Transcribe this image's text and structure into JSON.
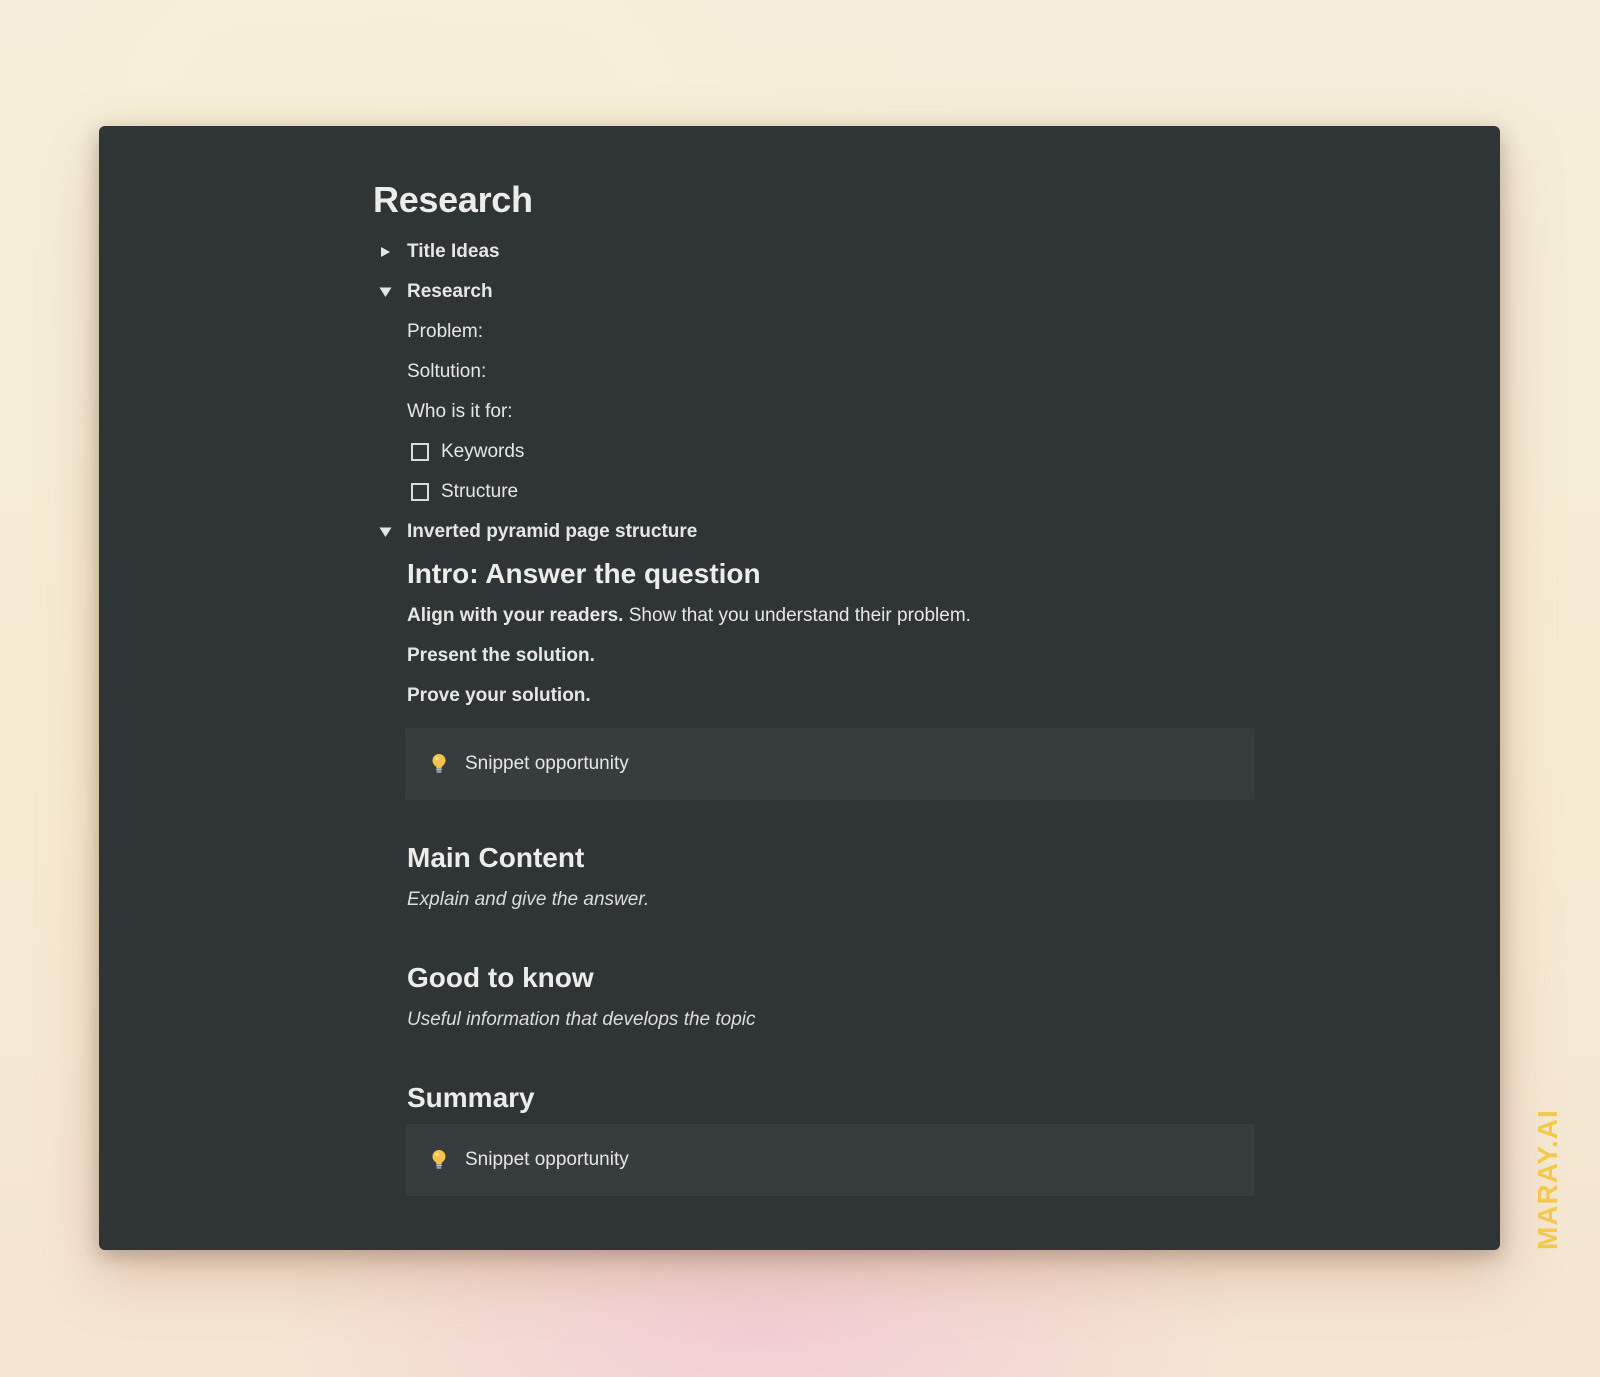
{
  "page": {
    "title": "Research"
  },
  "toggles": {
    "title_ideas": "Title Ideas",
    "research": "Research",
    "inverted": "Inverted pyramid page structure"
  },
  "research_items": {
    "problem": "Problem:",
    "solution": "Soltution:",
    "who": "Who is it for:"
  },
  "todos": [
    {
      "label": "Keywords",
      "checked": false
    },
    {
      "label": "Structure",
      "checked": false
    }
  ],
  "intro": {
    "heading": "Intro: Answer the question",
    "align_bold": "Align with your readers.",
    "align_rest": " Show that you understand their problem.",
    "present": "Present the solution.",
    "prove": "Prove your solution.",
    "callout": "Snippet opportunity"
  },
  "main_content": {
    "heading": "Main Content",
    "text": "Explain and give the answer."
  },
  "good_to_know": {
    "heading": "Good to know",
    "text": "Useful information that develops the topic"
  },
  "summary": {
    "heading": "Summary",
    "callout": "Snippet opportunity"
  },
  "watermark": "MARAY.AI",
  "icons": {
    "collapsed": "triangle-right-icon",
    "expanded": "triangle-down-icon",
    "callout": "lightbulb-icon"
  },
  "colors": {
    "window_bg": "#2f3437",
    "callout_bg": "#373c3f",
    "watermark": "#f2c94c"
  }
}
